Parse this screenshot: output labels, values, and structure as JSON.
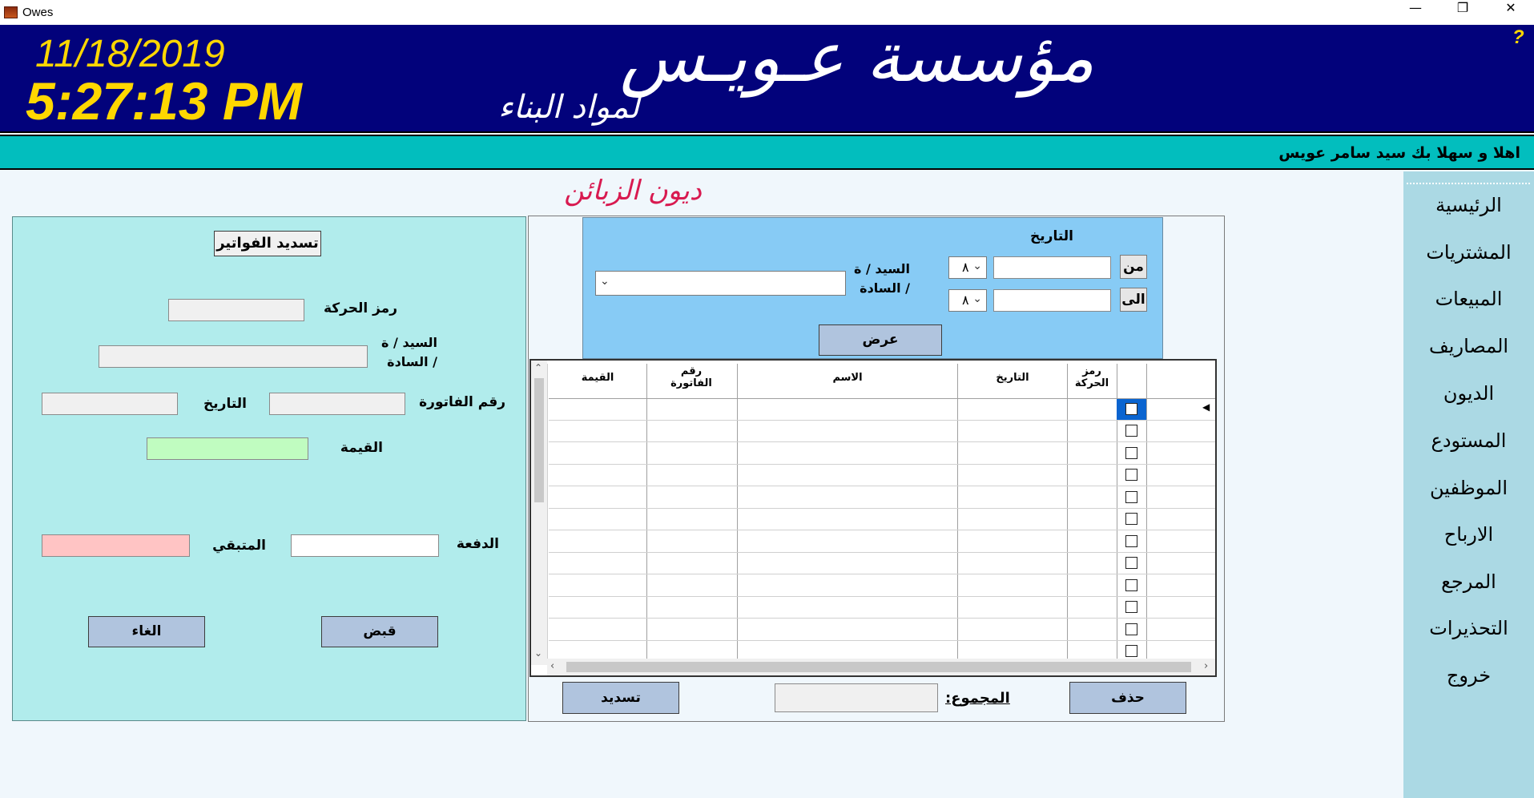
{
  "window": {
    "title": "Owes",
    "minimize": "—",
    "restore": "❐",
    "close": "✕"
  },
  "header": {
    "date": "11/18/2019",
    "time": "5:27:13 PM",
    "company": "مؤسسة عـويـس",
    "subtitle": "لمواد البناء",
    "help": "?"
  },
  "welcome": "اهلا و سهلا بك سيد سامر عويس",
  "sidebar": {
    "items": [
      "الرئيسية",
      "المشتريات",
      "المبيعات",
      "المصاريف",
      "الديون",
      "المستودع",
      "الموظفين",
      "الارباح",
      "المرجع",
      "التحذيرات",
      "خروج"
    ]
  },
  "page_title": "ديون الزبائن",
  "payment_panel": {
    "title": "تسديد الفواتير",
    "txn_code_label": "رمز الحركة",
    "customer_label_1": "السيد / ة",
    "customer_label_2": "/ السادة",
    "invoice_no_label": "رقم الفاتورة",
    "date_label": "التاريخ",
    "value_label": "القيمة",
    "payment_label": "الدفعة",
    "remaining_label": "المتبقي",
    "receive_button": "قبض",
    "cancel_button": "الغاء"
  },
  "filter": {
    "date_label": "التاريخ",
    "from_label": "من",
    "to_label": "الى",
    "month_from": "٨",
    "month_to": "٨",
    "customer_label_1": "السيد / ة",
    "customer_label_2": "/ السادة",
    "show_button": "عرض"
  },
  "table": {
    "columns": [
      "رمز الحركة",
      "التاريخ",
      "الاسم",
      "رقم الفاتورة",
      "القيمة"
    ],
    "rows": [
      "",
      "",
      "",
      "",
      "",
      "",
      "",
      "",
      "",
      "",
      "",
      ""
    ]
  },
  "footer": {
    "delete_button": "حذف",
    "total_label": "المجموع:",
    "pay_button": "تسديد"
  },
  "colors": {
    "header_bg": "#02027b",
    "welcome_bg": "#02bebe",
    "sidebar_bg": "#abd9e4",
    "panel_bg": "#b1ecec",
    "filter_bg": "#87cbf5",
    "value_bg": "#c0fcc0",
    "remaining_bg": "#ffc4c4",
    "button_bg": "#b0c4de",
    "date_time": "#ffd700",
    "title": "#d81a50"
  },
  "icons": {
    "app": "app-icon",
    "dropdown": "chevron-down-icon",
    "row_pointer": "row-pointer-icon"
  }
}
